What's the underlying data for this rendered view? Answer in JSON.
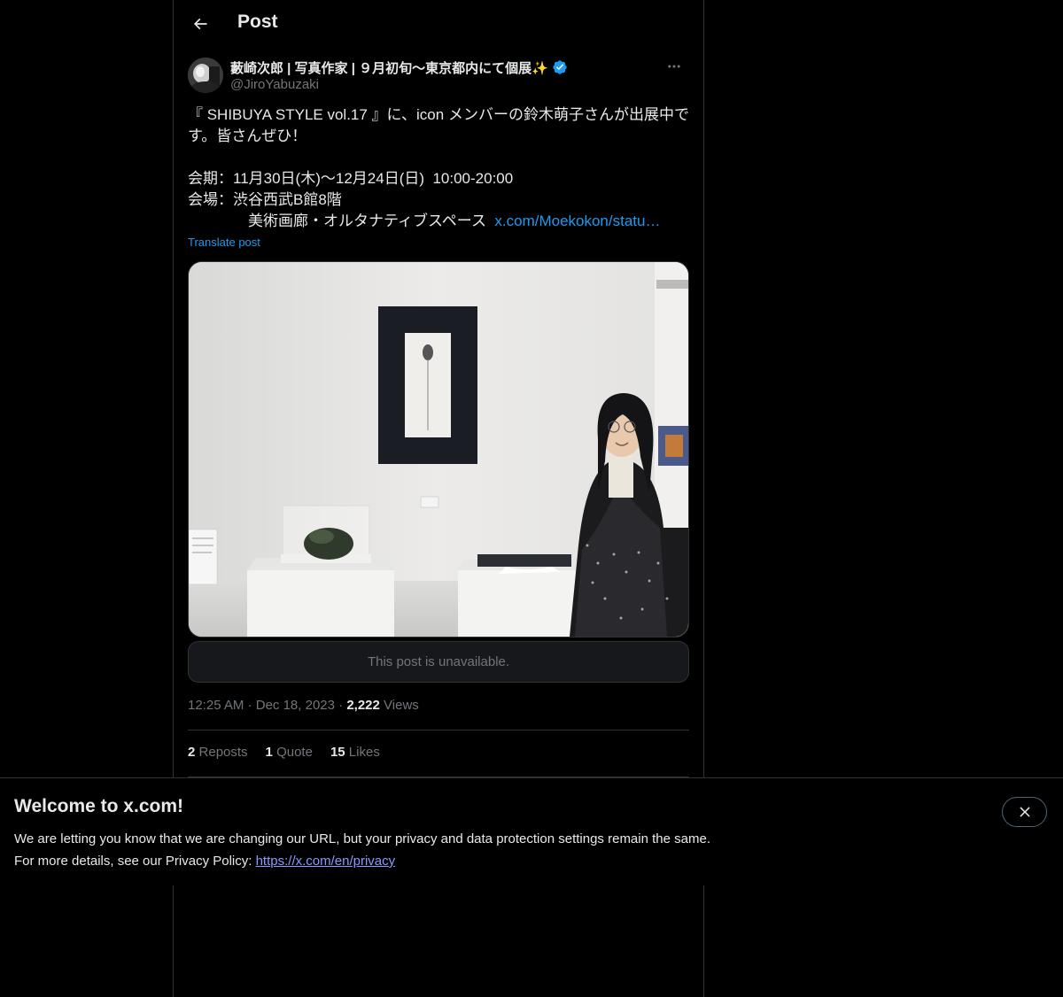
{
  "header": {
    "title": "Post",
    "back_icon": "arrow-left-icon"
  },
  "tweet": {
    "author": {
      "display_name": "藪崎次郎 | 写真作家 | ９月初旬〜東京都内にて個展✨",
      "handle": "@JiroYabuzaki",
      "verified": true
    },
    "text_line1": "『 SHIBUYA STYLE vol.17 』に、icon メンバーの鈴木萌子さんが出展中で",
    "text_line2": "す。皆さんぜひ！",
    "text_line3": "会期：11月30日(木)〜12月24日(日)  10:00-20:00",
    "text_line4": "会場：渋谷西武B館8階",
    "text_line5_prefix": "　　　　美術画廊・オルタナティブスペース  ",
    "text_link": "x.com/Moekokon/statu…",
    "translate_label": "Translate post",
    "quote_unavailable": "This post is unavailable.",
    "time": "12:25 AM",
    "date": "Dec 18, 2023",
    "views_count": "2,222",
    "views_label": "Views",
    "reposts_count": "2",
    "reposts_label": "Reposts",
    "quotes_count": "1",
    "quotes_label": "Quote",
    "likes_count": "15",
    "likes_label": "Likes"
  },
  "banner": {
    "title": "Welcome to x.com!",
    "line1": "We are letting you know that we are changing our URL, but your privacy and data protection settings remain the same.",
    "line2_prefix": "For more details, see our Privacy Policy: ",
    "privacy_link": "https://x.com/en/privacy",
    "close_icon": "close-icon"
  },
  "colors": {
    "background": "#000000",
    "text": "#e7e9ea",
    "secondary": "#71767b",
    "accent": "#1d9bf0",
    "border": "#2f3336",
    "banner_link": "#8b98ff"
  }
}
